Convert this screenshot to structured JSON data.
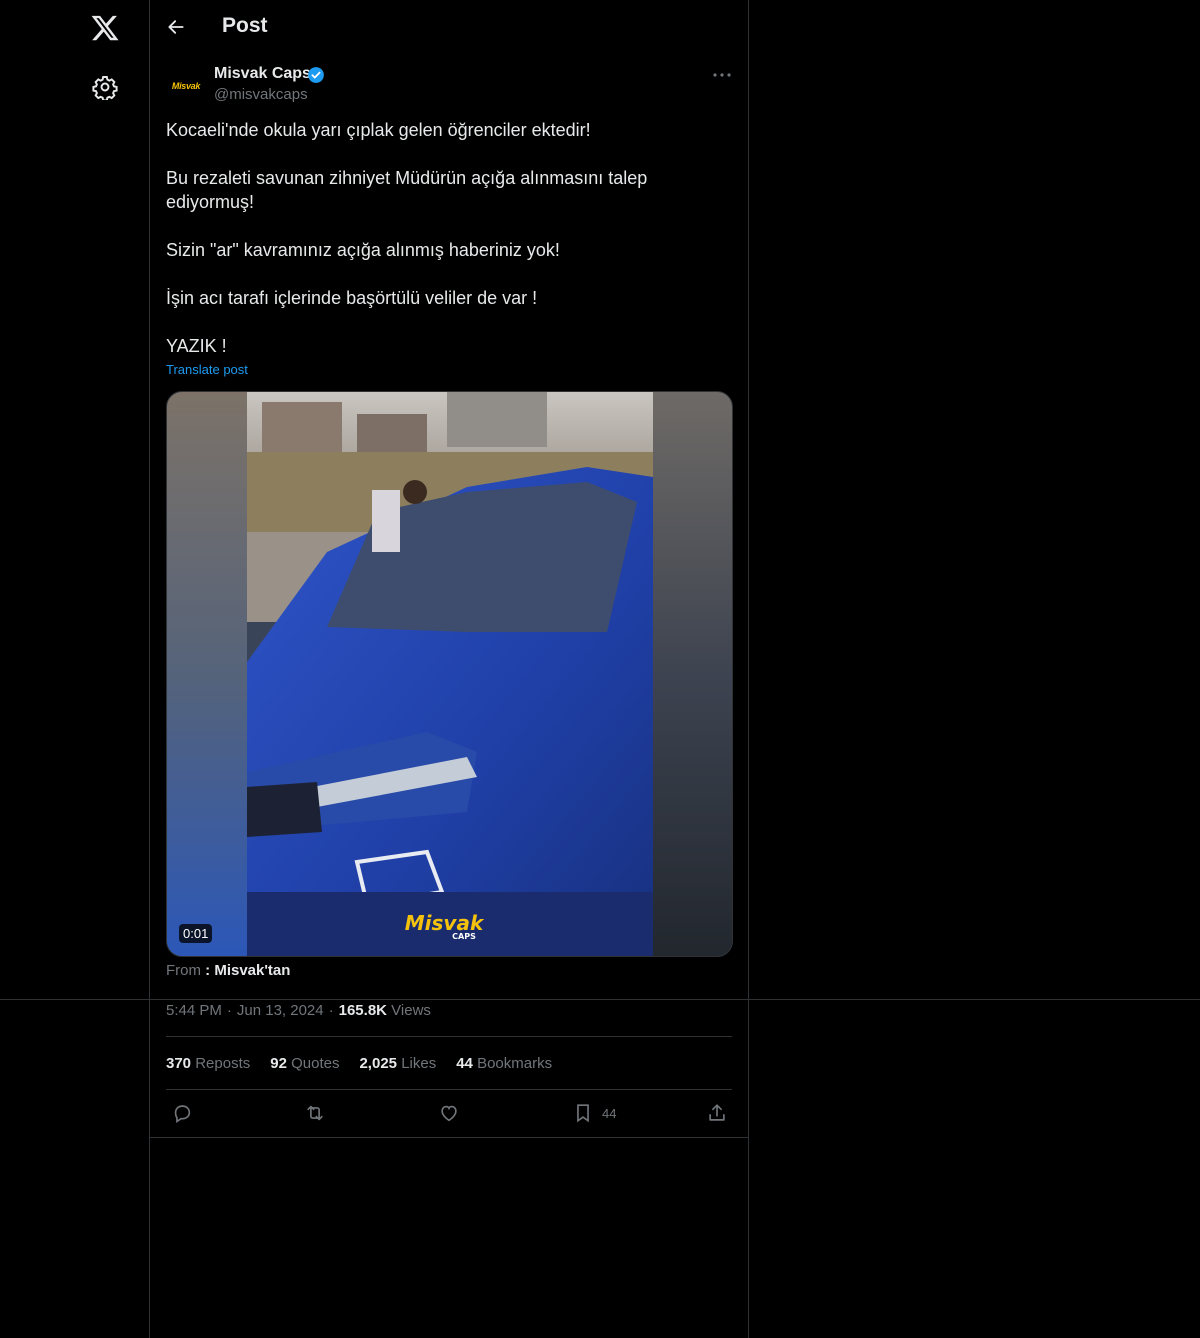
{
  "nav": {
    "logo_icon": "x-logo-icon",
    "settings_icon": "gear-icon"
  },
  "header": {
    "title": "Post"
  },
  "author": {
    "name": "Misvak Caps",
    "handle": "@misvakcaps",
    "avatar_text": "Misvak"
  },
  "tweet": {
    "paragraphs": [
      "Kocaeli'nde okula yarı çıplak gelen öğrenciler ektedir!",
      "Bu rezaleti savunan zihniyet Müdürün açığa alınmasını talep ediyormuş!",
      "Sizin \"ar\" kavramınız açığa alınmış haberiniz yok!",
      "İşin acı tarafı içlerinde başörtülü veliler de var !",
      "YAZIK !"
    ],
    "translate_label": "Translate post"
  },
  "media": {
    "duration": "0:01",
    "watermark_top": "Misvak",
    "watermark_bottom": "CAPS"
  },
  "source": {
    "prefix": "From",
    "name": ": Misvak'tan"
  },
  "meta": {
    "time": "5:44 PM",
    "date": "Jun 13, 2024",
    "views_count": "165.8K",
    "views_label": "Views"
  },
  "stats": {
    "reposts_count": "370",
    "reposts_label": "Reposts",
    "quotes_count": "92",
    "quotes_label": "Quotes",
    "likes_count": "2,025",
    "likes_label": "Likes",
    "bookmarks_count": "44",
    "bookmarks_label": "Bookmarks"
  },
  "actions": {
    "bookmark_count": "44"
  },
  "colors": {
    "accent": "#1d9bf0",
    "background": "#000000",
    "border": "#2f3336",
    "muted": "#71767b",
    "text": "#e7e9ea"
  }
}
